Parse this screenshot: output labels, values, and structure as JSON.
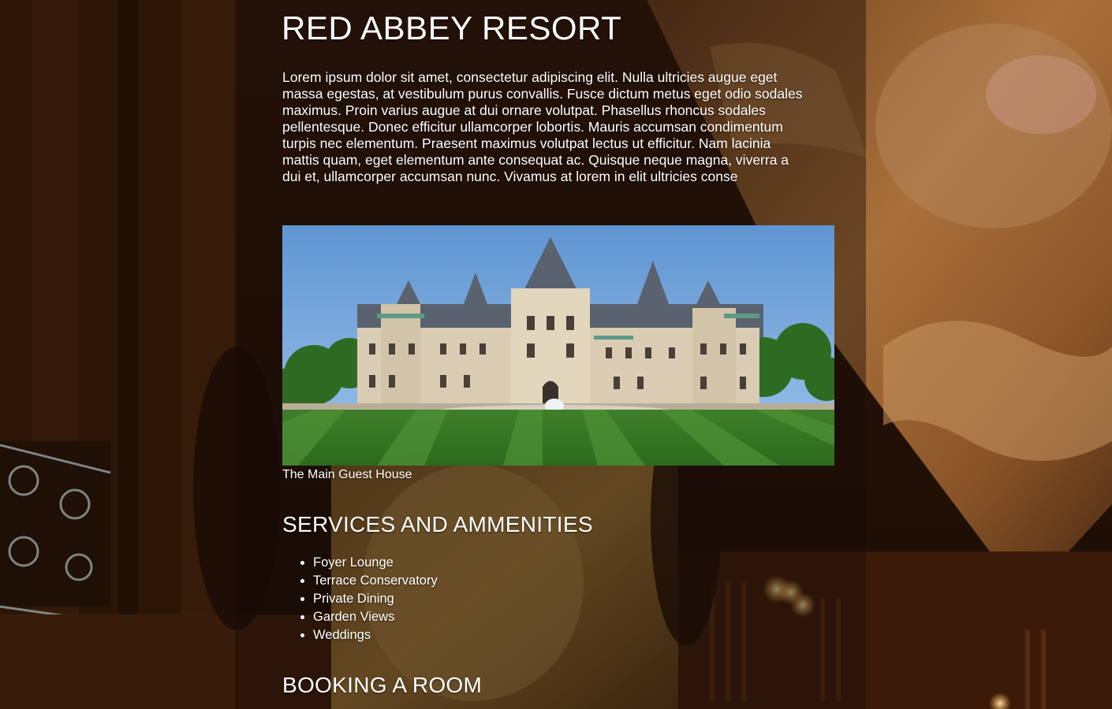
{
  "page": {
    "title": "RED ABBEY RESORT",
    "intro": "Lorem ipsum dolor sit amet, consectetur adipiscing elit. Nulla ultricies augue eget massa egestas, at vestibulum purus convallis. Fusce dictum metus eget odio sodales maximus. Proin varius augue at dui ornare volutpat. Phasellus rhoncus sodales pellentesque. Donec efficitur ullamcorper lobortis. Mauris accumsan condimentum turpis nec elementum. Praesent maximus volutpat lectus ut efficitur. Nam lacinia mattis quam, eget elementum ante consequat ac. Quisque neque magna, viverra a dui et, ullamcorper accumsan nunc. Vivamus at lorem in elit ultricies conse"
  },
  "photo": {
    "caption": "The Main Guest House"
  },
  "services": {
    "heading": "SERVICES AND AMMENITIES",
    "items": [
      "Foyer Lounge",
      "Terrace Conservatory",
      "Private Dining",
      "Garden Views",
      "Weddings"
    ]
  },
  "booking": {
    "heading": "BOOKING A ROOM"
  },
  "colors": {
    "text": "#ffffff",
    "panel_overlay": "rgba(22,12,6,0.42)"
  }
}
